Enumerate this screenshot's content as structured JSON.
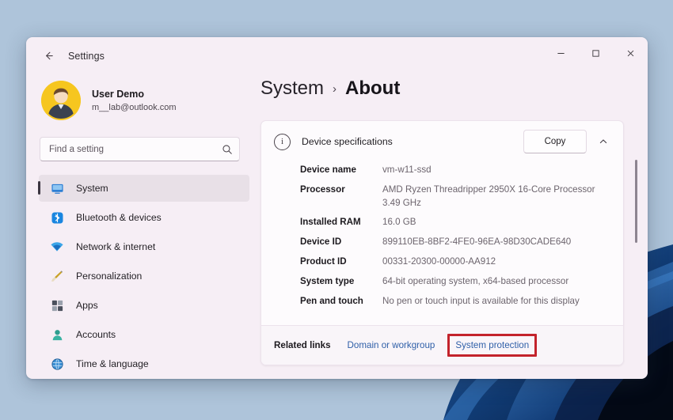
{
  "window": {
    "titlebar_label": "Settings",
    "back_icon": "back-arrow-icon",
    "minimize_label": "–",
    "maximize_label": "▫",
    "close_label": "✕"
  },
  "account": {
    "name": "User Demo",
    "email": "m__lab@outlook.com",
    "avatar_icon": "user-avatar-icon"
  },
  "search": {
    "placeholder": "Find a setting",
    "value": "",
    "icon": "search-icon"
  },
  "sidebar": {
    "items": [
      {
        "label": "System",
        "icon": "monitor-icon",
        "selected": true
      },
      {
        "label": "Bluetooth & devices",
        "icon": "bluetooth-icon",
        "selected": false
      },
      {
        "label": "Network & internet",
        "icon": "wifi-icon",
        "selected": false
      },
      {
        "label": "Personalization",
        "icon": "paintbrush-icon",
        "selected": false
      },
      {
        "label": "Apps",
        "icon": "apps-icon",
        "selected": false
      },
      {
        "label": "Accounts",
        "icon": "person-icon",
        "selected": false
      },
      {
        "label": "Time & language",
        "icon": "globe-clock-icon",
        "selected": false
      }
    ]
  },
  "breadcrumb": {
    "root": "System",
    "separator": "›",
    "current": "About"
  },
  "device_specifications": {
    "title": "Device specifications",
    "info_icon": "info-circle-icon",
    "copy_label": "Copy",
    "collapse_icon": "chevron-up-icon",
    "rows": [
      {
        "label": "Device name",
        "value": "vm-w11-ssd"
      },
      {
        "label": "Processor",
        "value": "AMD Ryzen Threadripper 2950X 16-Core Processor   3.49 GHz"
      },
      {
        "label": "Installed RAM",
        "value": "16.0 GB"
      },
      {
        "label": "Device ID",
        "value": "899110EB-8BF2-4FE0-96EA-98D30CADE640"
      },
      {
        "label": "Product ID",
        "value": "00331-20300-00000-AA912"
      },
      {
        "label": "System type",
        "value": "64-bit operating system, x64-based processor"
      },
      {
        "label": "Pen and touch",
        "value": "No pen or touch input is available for this display"
      }
    ]
  },
  "related_links": {
    "label": "Related links",
    "links": [
      {
        "label": "Domain or workgroup",
        "highlighted": false
      },
      {
        "label": "System protection",
        "highlighted": true
      }
    ]
  },
  "colors": {
    "window_background": "#f6eef5",
    "card_background": "#fdfbfd",
    "desktop_background": "#aec4da",
    "link": "#2f5fa8",
    "highlight_border": "#c3232c",
    "avatar_background": "#f6c61f",
    "accent_bar": "#3b3540"
  }
}
